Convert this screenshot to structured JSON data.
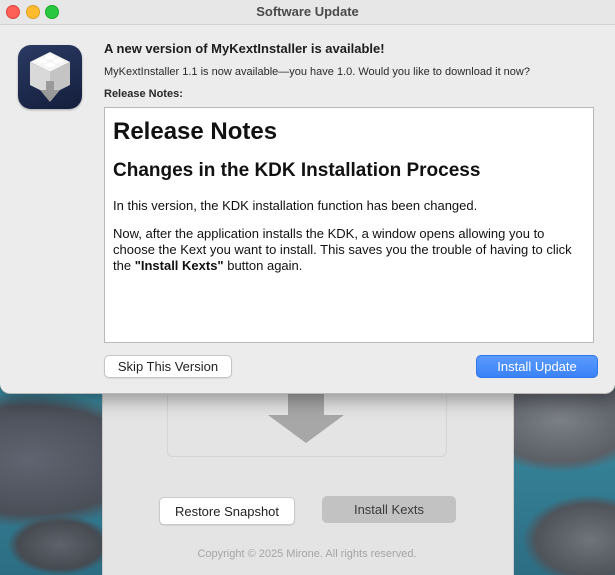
{
  "update_dialog": {
    "window_title": "Software Update",
    "headline": "A new version of MyKextInstaller is available!",
    "subline": "MyKextInstaller 1.1 is now available—you have 1.0. Would you like to download it now?",
    "release_notes_label": "Release Notes:",
    "notes": {
      "heading": "Release Notes",
      "subheading": "Changes in the KDK Installation Process",
      "paragraph1": "In this version, the KDK installation function has been changed.",
      "paragraph2_prefix": "Now, after the application installs the KDK, a window opens allowing you to choose the Kext you want to install. This saves you the trouble of having to click the ",
      "paragraph2_bold": "\"Install Kexts\"",
      "paragraph2_suffix": " button again."
    },
    "skip_label": "Skip This Version",
    "install_label": "Install Update",
    "accent_color": "#3a82f6"
  },
  "app_window": {
    "restore_label": "Restore Snapshot",
    "install_kexts_label": "Install Kexts",
    "copyright": "Copyright © 2025 Mirone. All rights reserved."
  },
  "icons": {
    "app_icon": "mykextinstaller-app-icon",
    "download_arrow": "download-arrow-icon"
  }
}
